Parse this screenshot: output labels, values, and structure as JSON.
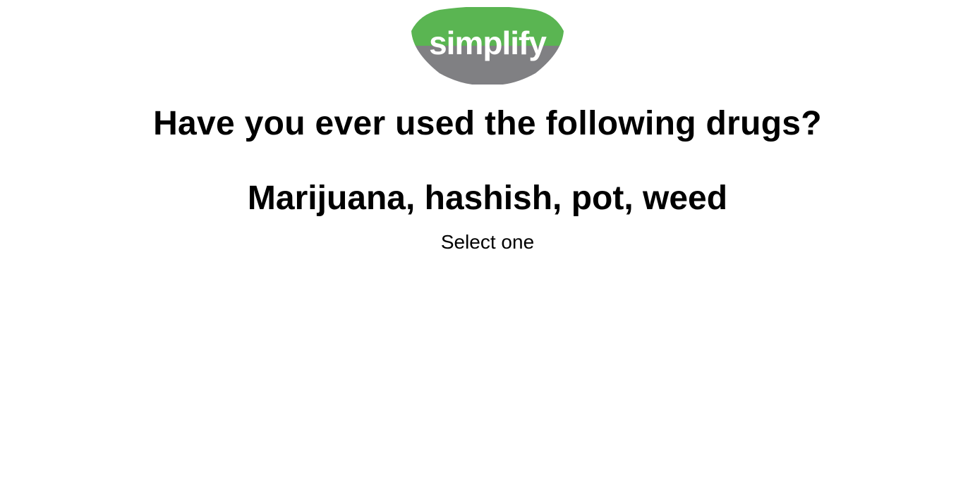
{
  "logo": {
    "brand_text": "simplify",
    "colors": {
      "top": "#5ab552",
      "bottom": "#808083",
      "text": "#ffffff"
    }
  },
  "question": {
    "text": "Have you ever used the following drugs?"
  },
  "item": {
    "text": "Marijuana, hashish, pot, weed"
  },
  "instruction": {
    "text": "Select one"
  }
}
